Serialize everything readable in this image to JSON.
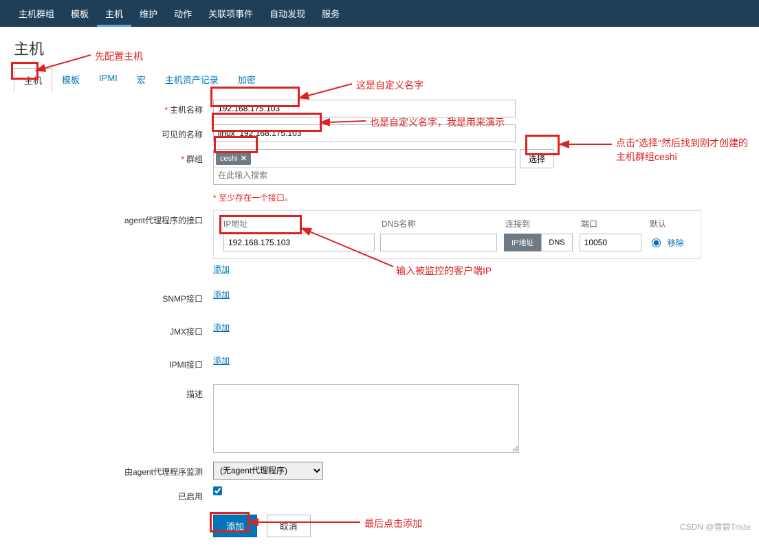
{
  "topnav": [
    "主机群组",
    "模板",
    "主机",
    "维护",
    "动作",
    "关联项事件",
    "自动发现",
    "服务"
  ],
  "page_title": "主机",
  "subtabs": [
    "主机",
    "模板",
    "IPMI",
    "宏",
    "主机资产记录",
    "加密"
  ],
  "labels": {
    "hostname": "主机名称",
    "visible": "可见的名称",
    "groups": "群组",
    "agent_if": "agent代理程序的接口",
    "snmp_if": "SNMP接口",
    "jmx_if": "JMX接口",
    "ipmi_if": "IPMI接口",
    "desc": "描述",
    "proxy": "由agent代理程序监测",
    "enabled": "已启用"
  },
  "fields": {
    "hostname": "192.168.175.103",
    "visible": "linux  192.168.175.103",
    "group_tag": "ceshi",
    "group_placeholder": "在此输入搜索",
    "select_btn": "选择",
    "error": "至少存在一个接口。",
    "if_headers": {
      "ip": "IP地址",
      "dns": "DNS名称",
      "conn": "连接到",
      "port": "端口",
      "def": "默认"
    },
    "if_row": {
      "ip": "192.168.175.103",
      "dns": "",
      "btn_ip": "IP地址",
      "btn_dns": "DNS",
      "port": "10050",
      "remove": "移除"
    },
    "add_link": "添加",
    "proxy_opt": "(无agent代理程序)",
    "btn_add": "添加",
    "btn_cancel": "取消"
  },
  "annotations": {
    "a1": "先配置主机",
    "a2": "这是自定义名字",
    "a3": "也是自定义名字，我是用来演示",
    "a4": "点击\"选择\"然后找到刚才创建的主机群组ceshi",
    "a5": "输入被监控的客户端IP",
    "a6": "最后点击添加"
  },
  "watermark": "CSDN @雪碧Triste"
}
